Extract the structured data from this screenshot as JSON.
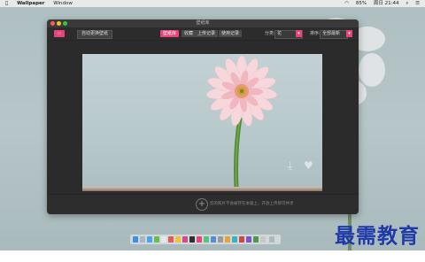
{
  "menubar": {
    "app_name": "Wallpaper",
    "menus": [
      "Window"
    ],
    "battery": "85%",
    "clock": "周日 21:44"
  },
  "window": {
    "title": "壁纸库"
  },
  "toolbar": {
    "auto_wallpaper_label": "自动更换壁纸",
    "tabs": [
      {
        "label": "壁纸库",
        "active": true
      },
      {
        "label": "收藏",
        "active": false
      },
      {
        "label": "上传记录",
        "active": false
      },
      {
        "label": "使用记录",
        "active": false
      }
    ],
    "category": {
      "label": "分类:",
      "value": "花"
    },
    "sort": {
      "label": "排序:",
      "value": "全部最新"
    }
  },
  "footer": {
    "hint": "您的照片不会被存在本服上，开放上传即可共享"
  },
  "watermark": "最需教育",
  "colors": {
    "accent": "#e8437d",
    "window_bg": "#2f2f2f",
    "watermark": "#1e3aa8"
  },
  "icons": [
    "apple-icon",
    "download-icon",
    "heart-icon",
    "add-icon",
    "close-icon",
    "minimize-icon",
    "maximize-icon"
  ]
}
